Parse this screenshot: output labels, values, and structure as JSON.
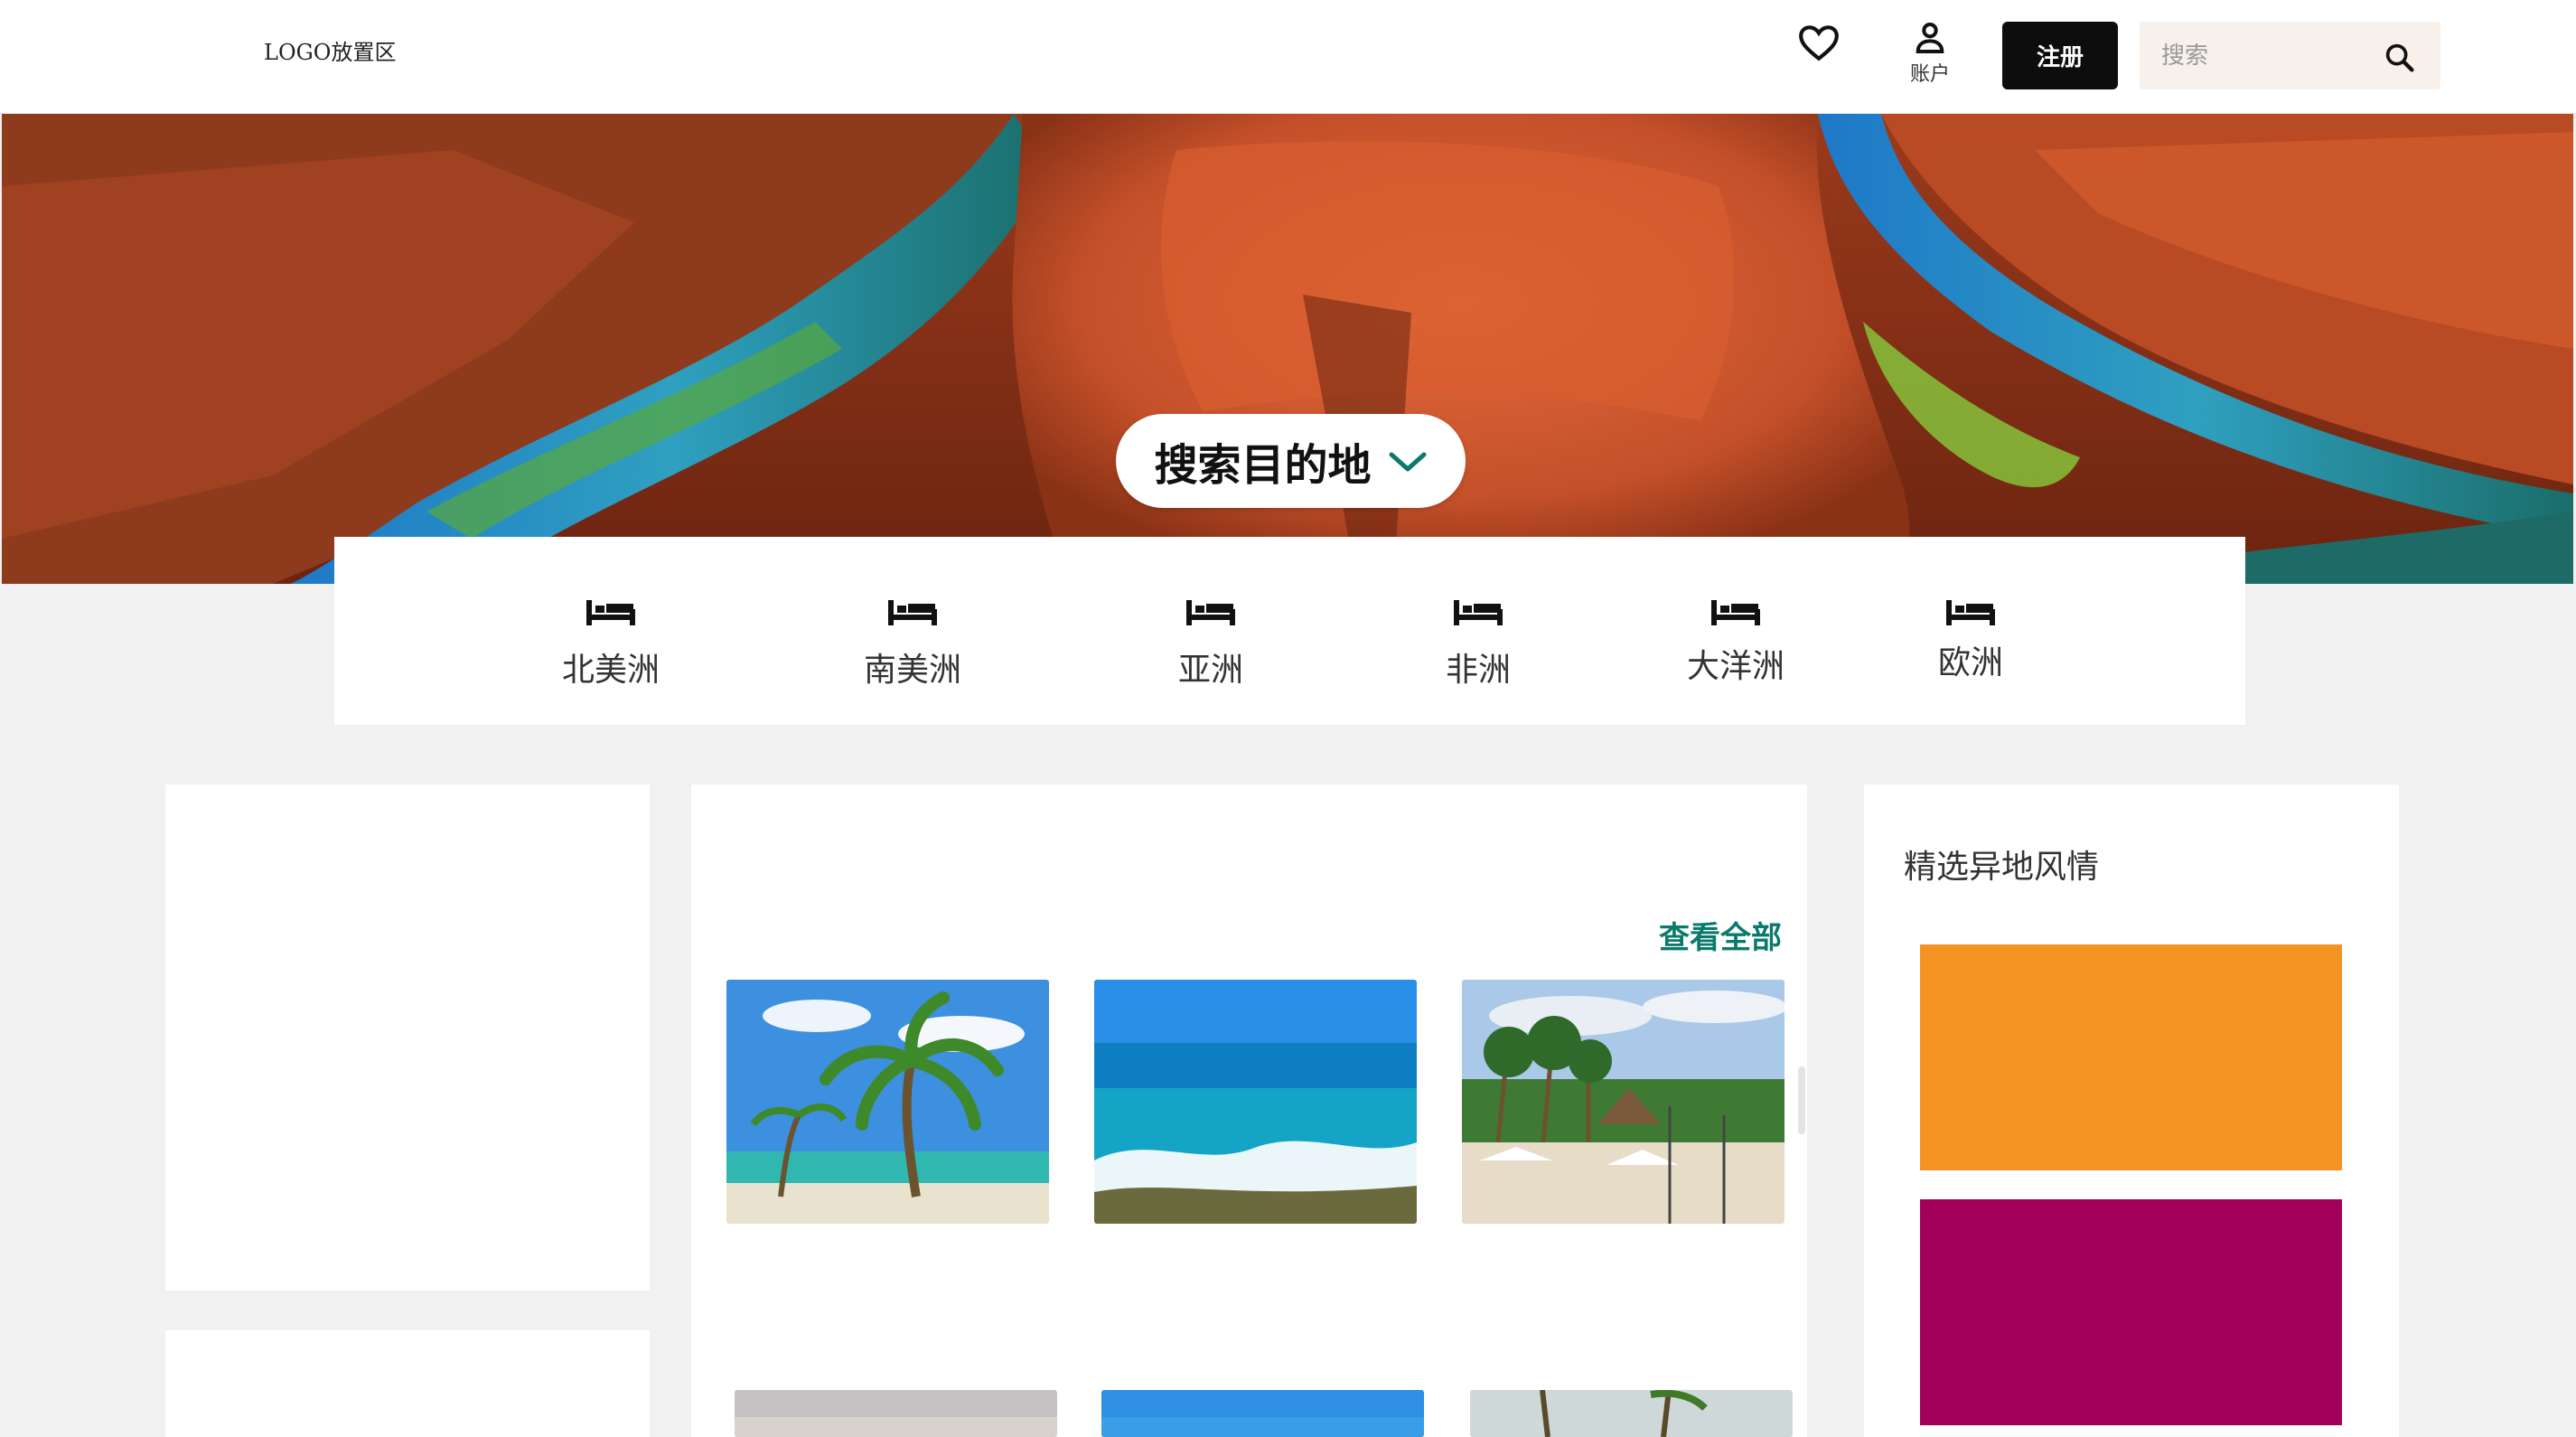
{
  "header": {
    "logo_text": "LOGO放置区",
    "favorites_icon": "heart-icon",
    "account_icon": "user-icon",
    "account_label": "账户",
    "register_label": "注册",
    "search_placeholder": "搜索",
    "search_icon": "search-icon"
  },
  "hero": {
    "destination_button_label": "搜索目的地",
    "destination_icon": "chevron-down-icon",
    "accent_color": "#0b7a6b"
  },
  "continents": [
    {
      "label": "北美洲",
      "icon": "bed-icon"
    },
    {
      "label": "南美洲",
      "icon": "bed-icon"
    },
    {
      "label": "亚洲",
      "icon": "bed-icon"
    },
    {
      "label": "非洲",
      "icon": "bed-icon"
    },
    {
      "label": "大洋洲",
      "icon": "bed-icon"
    },
    {
      "label": "欧洲",
      "icon": "bed-icon"
    }
  ],
  "featured": {
    "view_all_label": "查看全部",
    "view_all_color": "#0b7a6b"
  },
  "sidebar": {
    "title": "精选异地风情",
    "swatch_colors": [
      "#f59322",
      "#a0005a"
    ]
  }
}
